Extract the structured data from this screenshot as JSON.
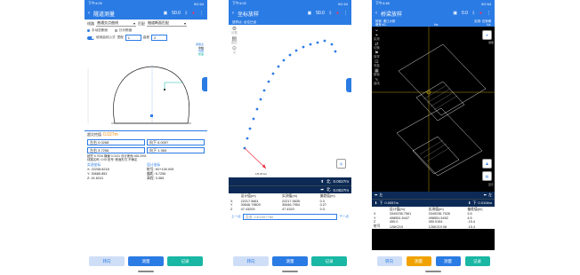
{
  "phone1": {
    "status_time": "下午4:09",
    "status_right": "5G 64",
    "title": "隧道测量",
    "signal": "50.0",
    "line_label": "线路",
    "line_value": "普通交点曲线",
    "section_label": "匹配",
    "section_value": "隧道断面匹配",
    "manual_label": "手动选断面",
    "auto_label": "针对断面",
    "toggle_label": "使用曲线公式",
    "start_label": "里程",
    "start_value": "1",
    "height_label": "高程",
    "height_value": "2",
    "legend": [
      "测量点",
      "中桩",
      "线路",
      "断面"
    ],
    "deviation_label": "超欠挖值",
    "deviation_value": "0.027m",
    "hz_left_label": "左右",
    "hz_left_value": "0.0268",
    "hz_right_label": "向下",
    "hz_right_value": "6.0057",
    "v_left_label": "左右",
    "v_left_value": "3.7256",
    "v_right_label": "向下",
    "v_right_value": "1.365",
    "ok_label": "断面状态",
    "info_line1": "超挖 6.7926 横偏 0.0131 设计断面 465.2591",
    "info_line2": "线路名称: 0.05 桩号: 断面形式 不确定",
    "coord_title": "实测坐标",
    "x_label": "X",
    "x_value": "22208.8218",
    "y_label": "Y",
    "y_value": "30685.853",
    "z_label": "Z",
    "z_value": "41.6241",
    "design_title": "设计坐标",
    "mileage_label": "桩号",
    "mileage_value": "K0+100.005",
    "offset_label": "偏距",
    "offset_value": "6.7256",
    "elev_label": "高程",
    "elev_value": "3.365",
    "btn_left": "转向",
    "btn_mid": "测量",
    "btn_right": "记录"
  },
  "phone2": {
    "status_time": "下午4:02",
    "status_right": "5G 64",
    "title": "坐标放样",
    "signal": "50.0",
    "subtitle": "放样点: 点位已设",
    "map_tools": [
      "设置",
      "图层",
      "点"
    ],
    "north_label": "北",
    "dist1_value": "0.0027m",
    "dist2_value": "0.0027m",
    "ruler_label": "1/5.00 km",
    "table_headers": [
      "设计值(m)",
      "实测值(m)",
      "偏差值(m)"
    ],
    "rows": [
      {
        "label": "X",
        "design": "22217.5661",
        "measured": "22217.5635",
        "diff": "0.3"
      },
      {
        "label": "Y",
        "design": "30646.79809",
        "measured": "30646.7954",
        "diff": "0.27"
      },
      {
        "label": "Z",
        "design": "47.43209",
        "measured": "47.4320",
        "diff": "0.3"
      }
    ],
    "prev_label": "上一点",
    "point_placeholder": "点名: CK100+760",
    "next_label": "下一点",
    "btn_left": "转向",
    "btn_mid": "测量",
    "btn_right": "记录"
  },
  "phone3": {
    "status_time": "下午4:48",
    "status_right": "5G 64",
    "title": "桥梁放样",
    "signal": "0.0",
    "info_left": "桥梁: 湘江大桥",
    "info_right": "实测: 在桥墩",
    "info_sub_left": "墩号:K1",
    "info_sub_mid": "Hz:",
    "info_sub_right": "Vz:",
    "tools": [
      "实测",
      "切换",
      "放样",
      "测量",
      "断面",
      "曲线"
    ],
    "side_tools": [
      "测量",
      "显示"
    ],
    "dir_left_label": "左",
    "dir_right_label": "左",
    "dir_down_left": "下",
    "dir_down_right": "下",
    "dist_left_value": "0.0057m",
    "dist_right_value": "0.0104m",
    "table_headers": [
      "设计值(m)",
      "实测值(m)",
      "偏差值(m)"
    ],
    "rows": [
      {
        "label": "X",
        "design": "3349236.7561",
        "measured": "3349236.7526",
        "diff": "3.5"
      },
      {
        "label": "Y",
        "design": "498551.5447",
        "measured": "498551.5452",
        "diff": "4.5"
      },
      {
        "label": "Z",
        "design": "450.0",
        "measured": "450.0164",
        "diff": "-15.4"
      }
    ],
    "pier_label": "桩号",
    "pier_value": "126K219",
    "pier_measured": "126K219.08",
    "pier_diff": "-15.4",
    "btn_1": "转向",
    "btn_2": "测量",
    "btn_3": "测量",
    "btn_4": "记录"
  }
}
